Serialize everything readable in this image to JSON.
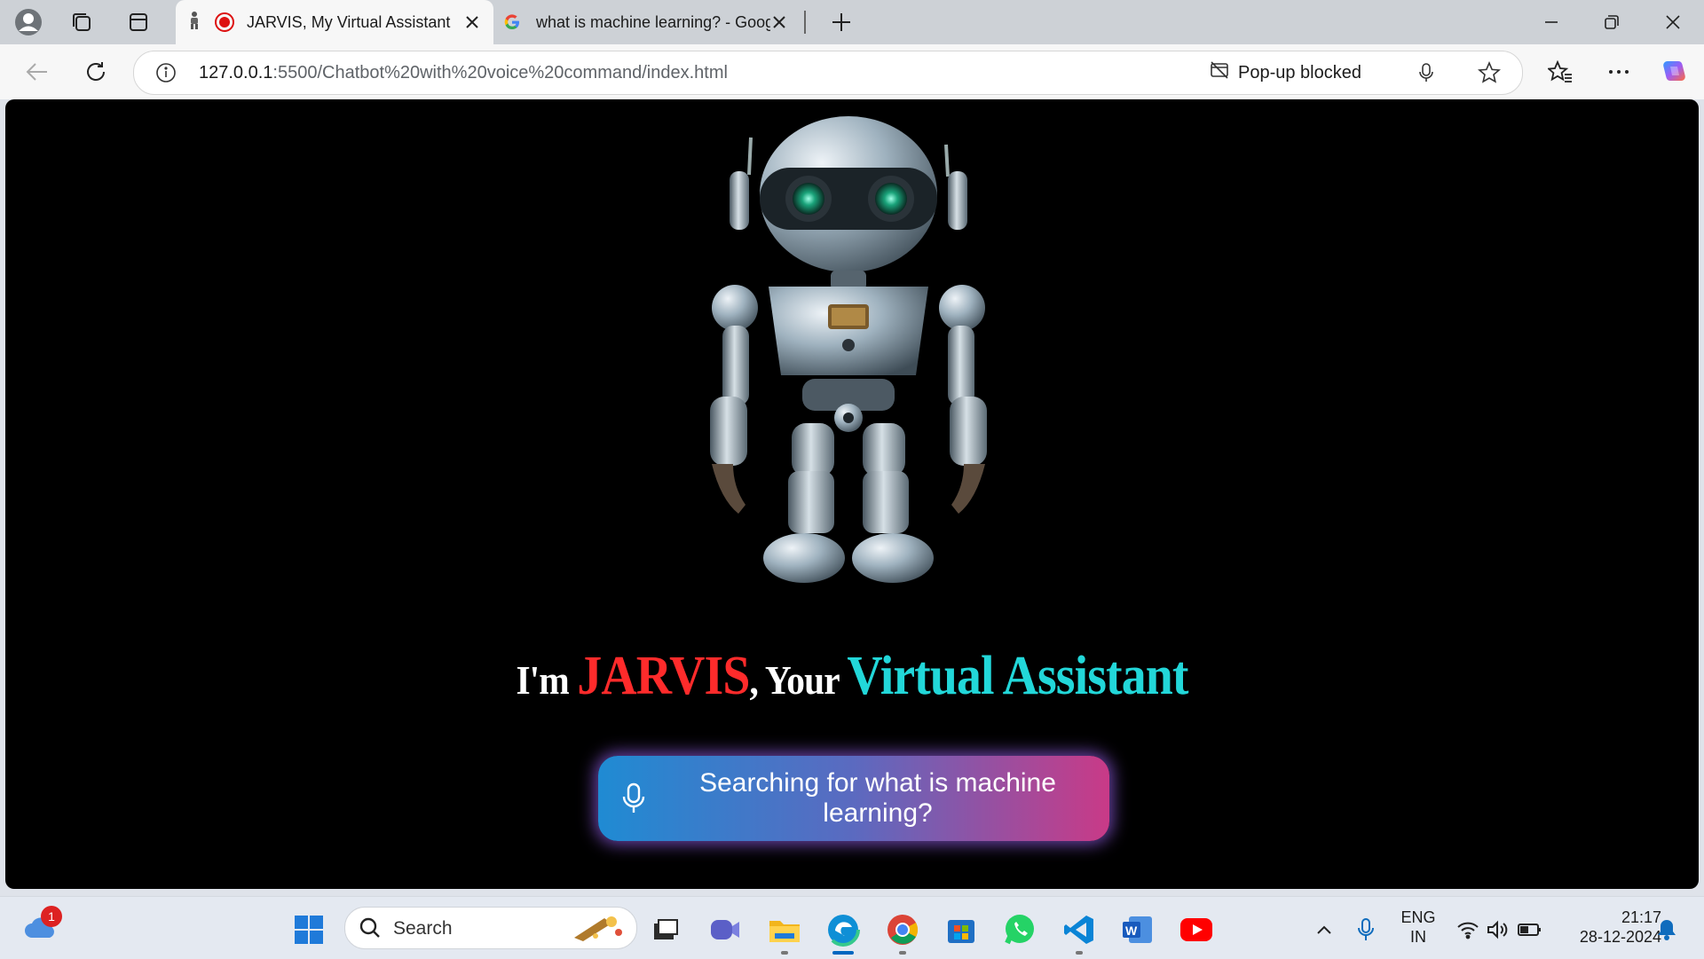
{
  "browser": {
    "tabs": [
      {
        "label": "JARVIS, My Virtual Assistant",
        "active": true,
        "recording": true
      },
      {
        "label": "what is machine learning? - Goog",
        "active": false
      }
    ],
    "address": {
      "host": "127.0.0.1",
      "path": ":5500/Chatbot%20with%20voice%20command/index.html"
    },
    "popup_blocked_label": "Pop-up blocked"
  },
  "page": {
    "headline": {
      "part1": "I'm ",
      "part2": "JARVIS",
      "part3": ", Your ",
      "part4": "Virtual Assistant"
    },
    "voice_button_text": "Searching for what is machine learning?"
  },
  "taskbar": {
    "weather_badge": "1",
    "search_placeholder": "Search",
    "lang_line1": "ENG",
    "lang_line2": "IN",
    "time": "21:17",
    "date": "28-12-2024",
    "apps": [
      "start-icon",
      "file-explorer-icon",
      "teams-icon",
      "edge-icon",
      "chrome-icon",
      "store-icon",
      "whatsapp-icon",
      "vscode-icon",
      "word-icon",
      "youtube-icon"
    ]
  },
  "colors": {
    "accent_red": "#ff2b2b",
    "accent_cyan": "#22d7d9",
    "button_gradient_start": "#1f8bd3",
    "button_gradient_end": "#c93a87"
  }
}
